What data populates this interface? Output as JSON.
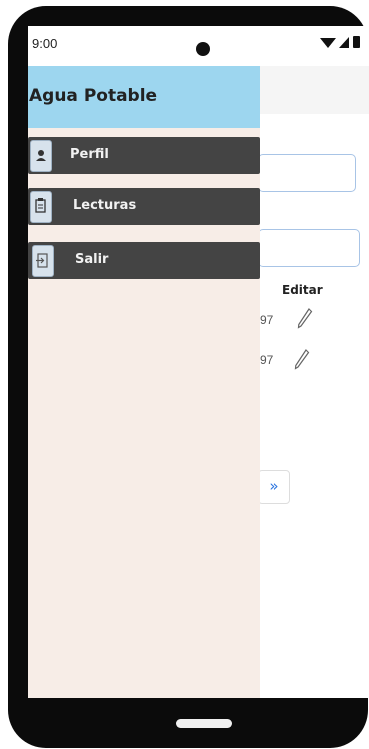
{
  "status": {
    "time": "9:00"
  },
  "drawer": {
    "title": "Agua Potable",
    "items": [
      {
        "label": "Perfil",
        "icon": "user-icon"
      },
      {
        "label": "Lecturas",
        "icon": "clipboard-icon"
      },
      {
        "label": "Salir",
        "icon": "logout-icon"
      }
    ]
  },
  "background": {
    "column_header": "Editar",
    "rows": [
      {
        "value": "97"
      },
      {
        "value": "97"
      }
    ],
    "next_symbol": "»"
  },
  "colors": {
    "drawer_header": "#9dd6ef",
    "drawer_bg": "#f7ede7",
    "menu_item": "#444444",
    "accent": "#2f77e0"
  }
}
